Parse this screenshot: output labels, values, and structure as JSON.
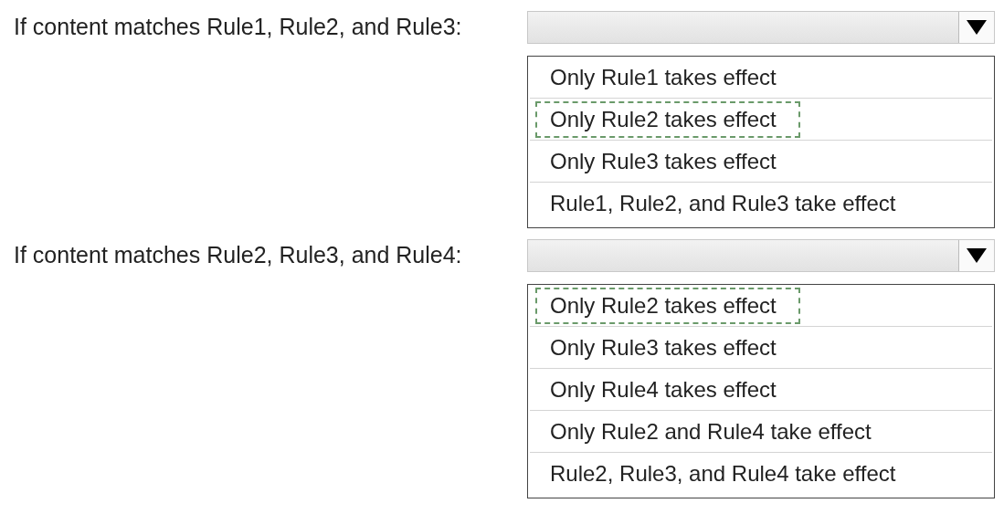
{
  "questions": [
    {
      "prompt": "If content matches Rule1, Rule2, and Rule3:",
      "options": [
        {
          "label": "Only Rule1 takes effect",
          "selected": false
        },
        {
          "label": "Only Rule2 takes effect",
          "selected": true
        },
        {
          "label": "Only Rule3 takes effect",
          "selected": false
        },
        {
          "label": "Rule1, Rule2, and Rule3 take effect",
          "selected": false
        }
      ]
    },
    {
      "prompt": "If content matches Rule2, Rule3, and Rule4:",
      "options": [
        {
          "label": "Only Rule2 takes effect",
          "selected": true
        },
        {
          "label": "Only Rule3 takes effect",
          "selected": false
        },
        {
          "label": "Only Rule4 takes effect",
          "selected": false
        },
        {
          "label": "Only Rule2 and Rule4 take effect",
          "selected": false
        },
        {
          "label": "Rule2, Rule3, and Rule4 take effect",
          "selected": false
        }
      ]
    }
  ]
}
